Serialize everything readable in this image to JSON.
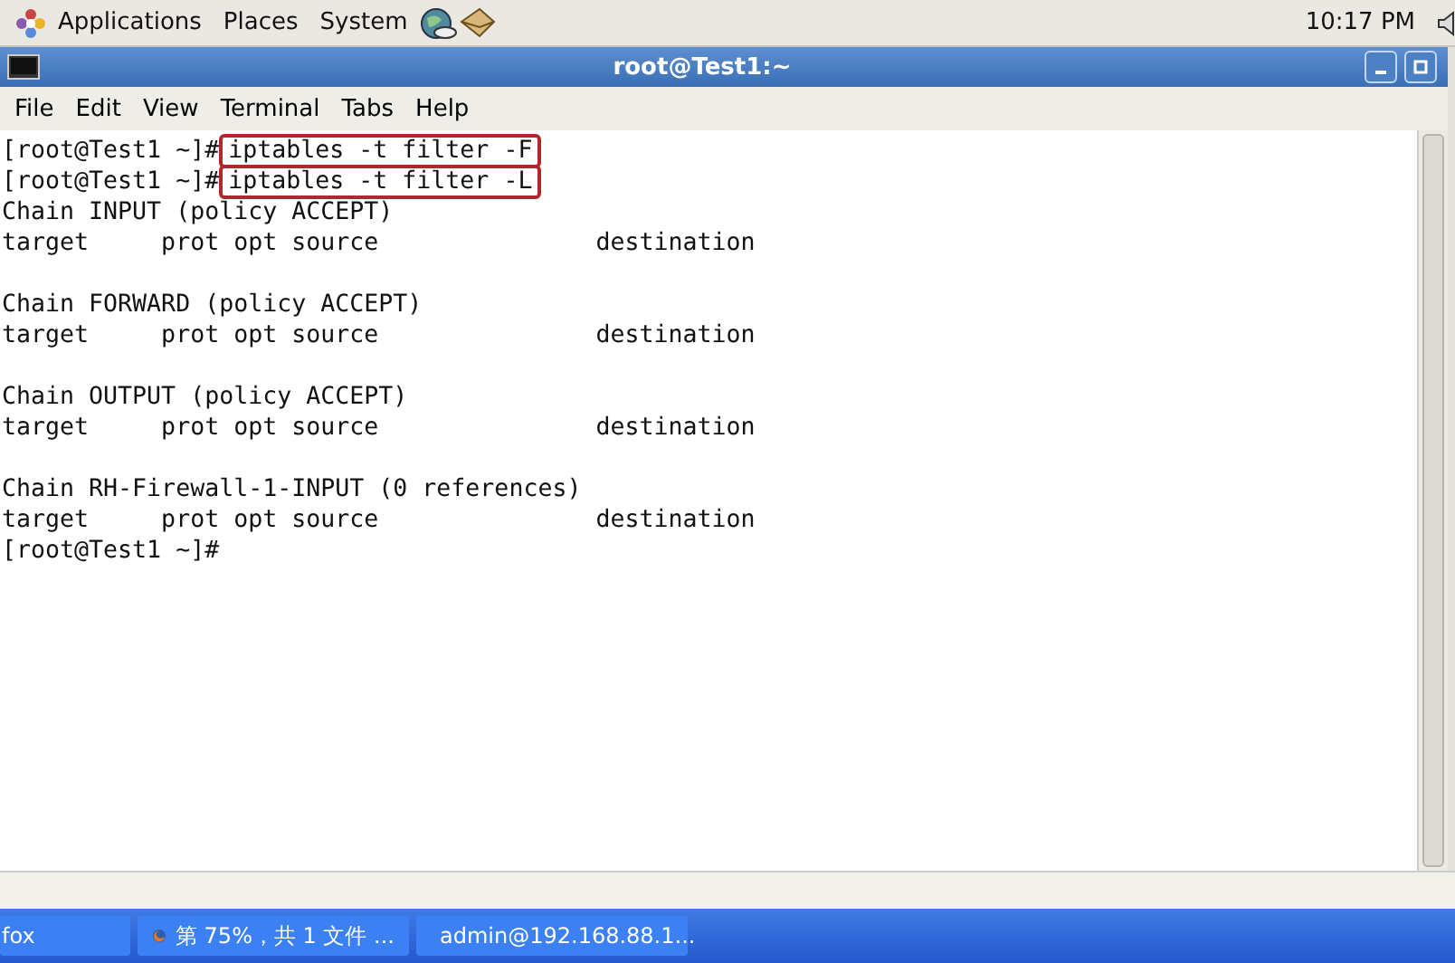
{
  "top_panel": {
    "menus": [
      "Applications",
      "Places",
      "System"
    ],
    "clock": "10:17 PM"
  },
  "window": {
    "title": "root@Test1:~"
  },
  "menu_bar": [
    "File",
    "Edit",
    "View",
    "Terminal",
    "Tabs",
    "Help"
  ],
  "terminal": {
    "lines": [
      {
        "kind": "command",
        "prompt": "[root@Test1 ~]#",
        "command": "iptables -t filter -F",
        "highlighted": true
      },
      {
        "kind": "command",
        "prompt": "[root@Test1 ~]#",
        "command": "iptables -t filter -L",
        "highlighted": true
      },
      {
        "kind": "output",
        "text": "Chain INPUT (policy ACCEPT)"
      },
      {
        "kind": "output",
        "text": "target     prot opt source               destination"
      },
      {
        "kind": "blank"
      },
      {
        "kind": "output",
        "text": "Chain FORWARD (policy ACCEPT)"
      },
      {
        "kind": "output",
        "text": "target     prot opt source               destination"
      },
      {
        "kind": "blank"
      },
      {
        "kind": "output",
        "text": "Chain OUTPUT (policy ACCEPT)"
      },
      {
        "kind": "output",
        "text": "target     prot opt source               destination"
      },
      {
        "kind": "blank"
      },
      {
        "kind": "output",
        "text": "Chain RH-Firewall-1-INPUT (0 references)"
      },
      {
        "kind": "output",
        "text": "target     prot opt source               destination"
      },
      {
        "kind": "command",
        "prompt": "[root@Test1 ~]#"
      }
    ]
  },
  "taskbar": {
    "items": [
      {
        "kind": "partial",
        "label": "fox"
      },
      {
        "kind": "browser",
        "label": "第 75%，共 1 文件 ..."
      },
      {
        "kind": "terminal",
        "label": "admin@192.168.88.1..."
      }
    ]
  }
}
